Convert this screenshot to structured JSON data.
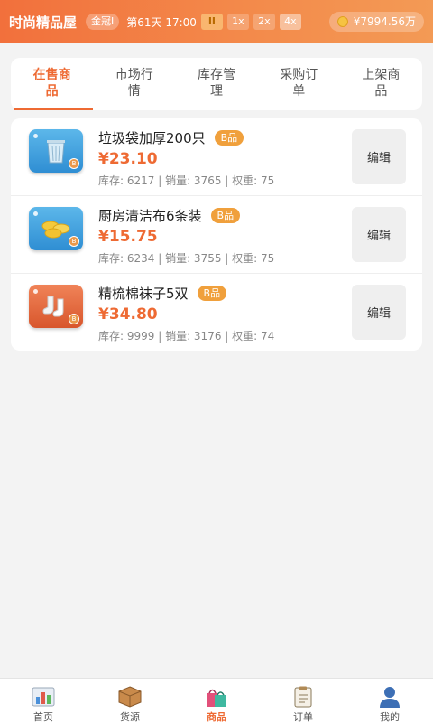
{
  "header": {
    "shop_name": "时尚精品屋",
    "rank_badge": "金冠I",
    "day_time": "第61天 17:00",
    "speed_options": [
      "II",
      "1x",
      "2x",
      "4x"
    ],
    "active_speed": "4x",
    "money": "¥7994.56万"
  },
  "tabs": [
    {
      "label": "在售商品",
      "active": true
    },
    {
      "label": "市场行情",
      "active": false
    },
    {
      "label": "库存管理",
      "active": false
    },
    {
      "label": "采购订单",
      "active": false
    },
    {
      "label": "上架商品",
      "active": false
    }
  ],
  "products": [
    {
      "name": "垃圾袋加厚200只",
      "tag": "B品",
      "price": "¥23.10",
      "stats": "库存: 6217 | 销量: 3765 | 权重: 75",
      "icon": "trash-bin-icon",
      "color": "#3a9ad9",
      "edit_label": "编辑"
    },
    {
      "name": "厨房清洁布6条装",
      "tag": "B品",
      "price": "¥15.75",
      "stats": "库存: 6234 | 销量: 3755 | 权重: 75",
      "icon": "sponges-icon",
      "color": "#3a9ad9",
      "edit_label": "编辑"
    },
    {
      "name": "精梳棉袜子5双",
      "tag": "B品",
      "price": "¥34.80",
      "stats": "库存: 9999 | 销量: 3176 | 权重: 74",
      "icon": "socks-icon",
      "color": "#e06a3c",
      "edit_label": "编辑"
    }
  ],
  "bottom_nav": [
    {
      "label": "首页",
      "icon": "bar-chart-icon",
      "active": false
    },
    {
      "label": "货源",
      "icon": "package-icon",
      "active": false
    },
    {
      "label": "商品",
      "icon": "shopping-bags-icon",
      "active": true
    },
    {
      "label": "订单",
      "icon": "clipboard-icon",
      "active": false
    },
    {
      "label": "我的",
      "icon": "user-icon",
      "active": false
    }
  ],
  "colors": {
    "accent": "#ee6a33",
    "header_start": "#f2703c",
    "tag": "#f0a03c"
  }
}
